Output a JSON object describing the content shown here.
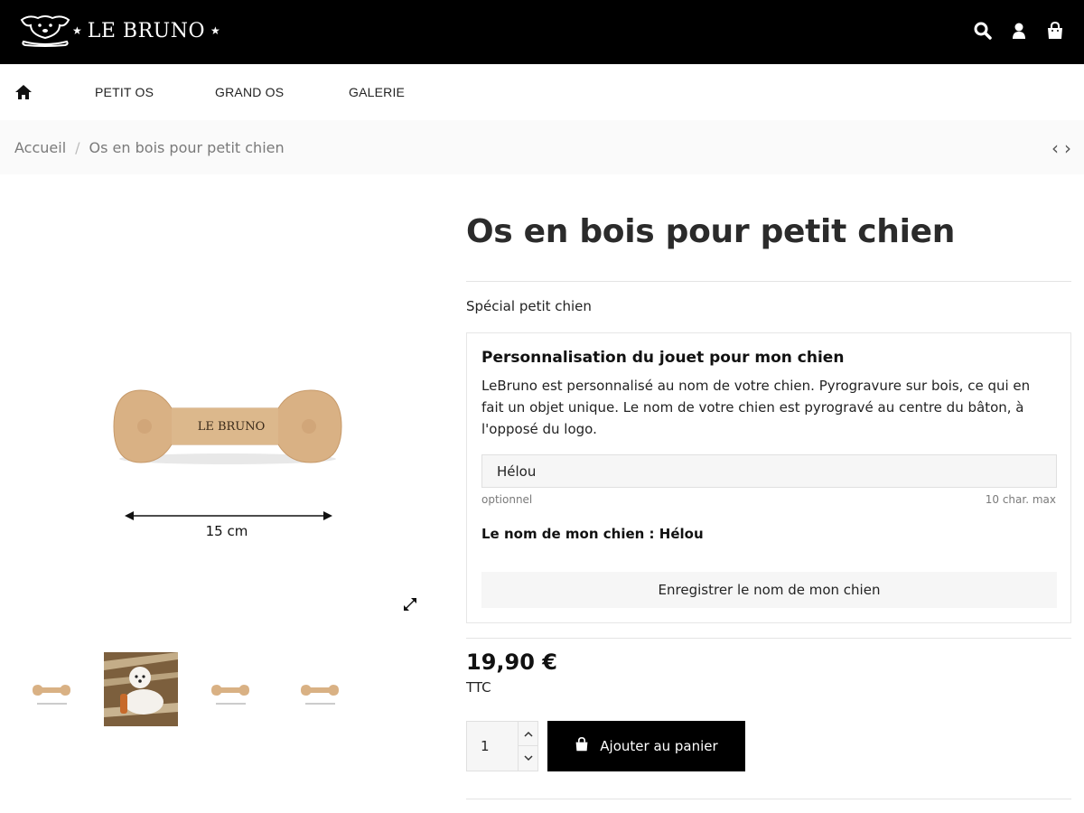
{
  "header": {
    "brand": "LE BRUNO",
    "star": "★",
    "icons": [
      "search-icon",
      "user-icon",
      "shopping-bag-icon"
    ]
  },
  "nav": {
    "items": [
      {
        "label": "PETIT OS"
      },
      {
        "label": "GRAND OS"
      },
      {
        "label": "GALERIE"
      }
    ]
  },
  "breadcrumb": {
    "home": "Accueil",
    "separator": "/",
    "current": "Os en bois pour petit chien"
  },
  "pager": {
    "prev": "‹",
    "next": "›"
  },
  "product": {
    "image_caption": "15 cm",
    "image_brand": "LE BRUNO",
    "title": "Os en bois pour petit chien",
    "short_description": "Spécial petit chien",
    "price": "19,90 €",
    "tax_label": "TTC"
  },
  "customization": {
    "title": "Personnalisation du jouet pour mon chien",
    "description": "LeBruno est personnalisé au nom de votre chien. Pyrogravure sur bois, ce qui en fait un objet unique. Le nom de votre chien est pyrogravé au centre du bâton, à l'opposé du logo.",
    "input_value": "Hélou",
    "hint_left": "optionnel",
    "hint_right": "10 char. max",
    "saved_name": "Le nom de mon chien : Hélou",
    "save_button": "Enregistrer le nom de mon chien"
  },
  "cart": {
    "quantity": "1",
    "add_button": "Ajouter au panier"
  },
  "colors": {
    "header_bg": "#000000",
    "accent": "#000000",
    "wood": "#d9b184"
  }
}
